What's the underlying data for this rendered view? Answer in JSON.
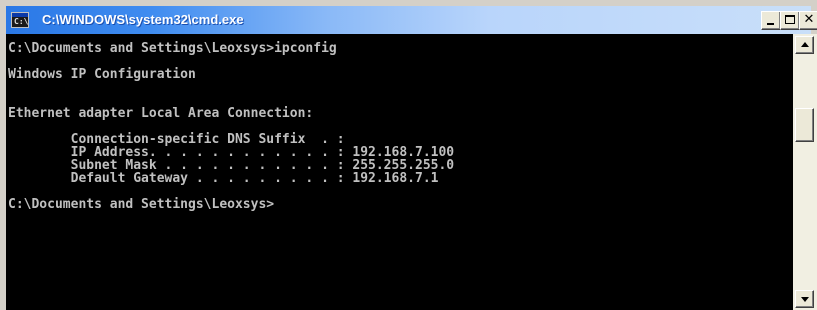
{
  "window": {
    "title": "C:\\WINDOWS\\system32\\cmd.exe",
    "icon": "cmd-icon",
    "icon_glyph": "C:\\"
  },
  "console": {
    "lines": [
      "C:\\Documents and Settings\\Leoxsys>ipconfig",
      "",
      "Windows IP Configuration",
      "",
      "",
      "Ethernet adapter Local Area Connection:",
      "",
      "        Connection-specific DNS Suffix  . :",
      "        IP Address. . . . . . . . . . . . : 192.168.7.100",
      "        Subnet Mask . . . . . . . . . . . : 255.255.255.0",
      "        Default Gateway . . . . . . . . . : 192.168.7.1",
      "",
      "C:\\Documents and Settings\\Leoxsys>"
    ]
  },
  "colors": {
    "console_bg": "#000000",
    "console_fg": "#c0c0c0",
    "titlebar_start": "#2a78e6",
    "titlebar_end": "#c9dff9"
  },
  "icons": {
    "minimize": "minimize-icon",
    "maximize": "maximize-icon",
    "close": "close-icon",
    "scroll_up": "arrow-up-icon",
    "scroll_down": "arrow-down-icon"
  }
}
